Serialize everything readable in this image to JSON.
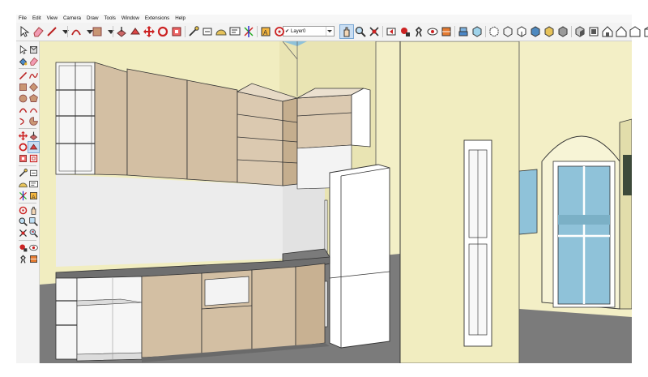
{
  "menu": [
    "File",
    "Edit",
    "View",
    "Camera",
    "Draw",
    "Tools",
    "Window",
    "Extensions",
    "Help"
  ],
  "toolbar": {
    "layer_value": "Layer0",
    "icons": [
      "select-icon",
      "eraser-icon",
      "line-icon",
      "line-dropdown-icon",
      "arc-icon",
      "arc-dropdown-icon",
      "shape-icon",
      "shape-dropdown-icon",
      "push-pull-icon",
      "follow-me-icon",
      "move-icon",
      "rotate-icon",
      "scale-icon",
      "tape-measure-icon",
      "dimension-icon",
      "protractor-icon",
      "text-icon",
      "axes-icon",
      "3d-text-icon",
      "orbit-icon",
      "pan-icon",
      "zoom-icon",
      "zoom-extents-icon",
      "previous-view-icon",
      "position-camera-icon",
      "walk-icon",
      "look-around-icon",
      "section-plane-icon",
      "layer-manager-icon",
      "xray-icon",
      "back-edges-icon",
      "wireframe-icon",
      "hidden-line-icon",
      "shaded-icon",
      "shaded-textures-icon",
      "monochrome-icon",
      "iso-view-icon",
      "top-view-icon",
      "front-view-icon",
      "right-view-icon",
      "back-view-icon",
      "left-view-icon"
    ]
  },
  "sidebar": {
    "icons": [
      "select-icon",
      "make-component-icon",
      "paint-bucket-icon",
      "eraser-icon",
      "line-icon",
      "freehand-icon",
      "rectangle-icon",
      "rotated-rectangle-icon",
      "circle-icon",
      "polygon-icon",
      "arc-icon",
      "two-point-arc-icon",
      "three-point-arc-icon",
      "pie-icon",
      "move-icon",
      "push-pull-icon",
      "rotate-icon",
      "follow-me-icon",
      "scale-icon",
      "offset-icon",
      "tape-measure-icon",
      "dimension-icon",
      "protractor-icon",
      "text-icon",
      "axes-icon",
      "3d-text-icon",
      "orbit-icon",
      "pan-icon",
      "zoom-icon",
      "zoom-window-icon",
      "zoom-extents-icon",
      "previous-icon",
      "position-camera-icon",
      "look-around-icon",
      "walk-icon",
      "section-plane-icon"
    ]
  },
  "colors": {
    "wall": "#f1edc0",
    "wall_shade": "#e4dfab",
    "cabinet": "#d3bfa3",
    "countertop": "#6f6f6f",
    "floor": "#7b7b7b",
    "fridge": "#ffffff",
    "glass": "#8fc2d9",
    "accent_active": "#c9def3"
  }
}
